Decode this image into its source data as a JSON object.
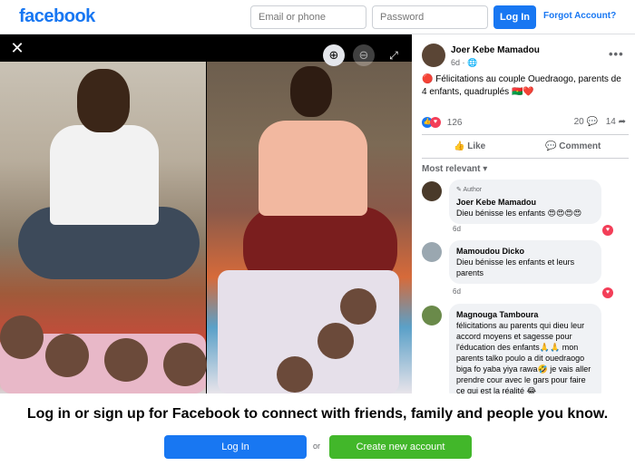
{
  "header": {
    "logo": "facebook",
    "email_placeholder": "Email or phone",
    "password_placeholder": "Password",
    "login_label": "Log In",
    "forgot_label": "Forgot Account?"
  },
  "viewer": {
    "close_icon": "close-icon",
    "zoom_in_icon": "zoom-in-icon",
    "zoom_out_icon": "zoom-out-icon",
    "fullscreen_icon": "fullscreen-icon"
  },
  "post": {
    "author": "Joer Kebe Mamadou",
    "time": "6d",
    "privacy_icon": "globe-icon",
    "text": "🔴 Félicitations au couple Ouedraogo, parents de 4 enfants, quadruplés 🇧🇫❤️",
    "reaction_count": "126",
    "comment_count": "20",
    "share_count": "14",
    "like_label": "Like",
    "comment_label": "Comment",
    "sort_label": "Most relevant"
  },
  "comments": [
    {
      "author_badge": "Author",
      "name": "Joer Kebe Mamadou",
      "text": "Dieu bénisse les enfants 😍😍😍😍",
      "time": "6d"
    },
    {
      "name": "Mamoudou Dicko",
      "text": "Dieu bénisse les enfants et leurs parents",
      "time": "6d"
    },
    {
      "name": "Magnouga Tamboura",
      "text": "félicitations au parents qui dieu leur accord moyens et sagesse pour l'éducation des enfants🙏🙏 mon parents talko poulo a dit ouedraogo biga fo yaba yiya rawa🤣 je vais aller prendre cour avec le gars pour faire ce qui est la réalité 😂"
    }
  ],
  "footer": {
    "title": "Log in or sign up for Facebook to connect with friends, family and people you know.",
    "login_label": "Log In",
    "or_label": "or",
    "create_label": "Create new account"
  },
  "colors": {
    "brand": "#1877f2",
    "create_green": "#42b72a",
    "heart": "#f33e58"
  }
}
